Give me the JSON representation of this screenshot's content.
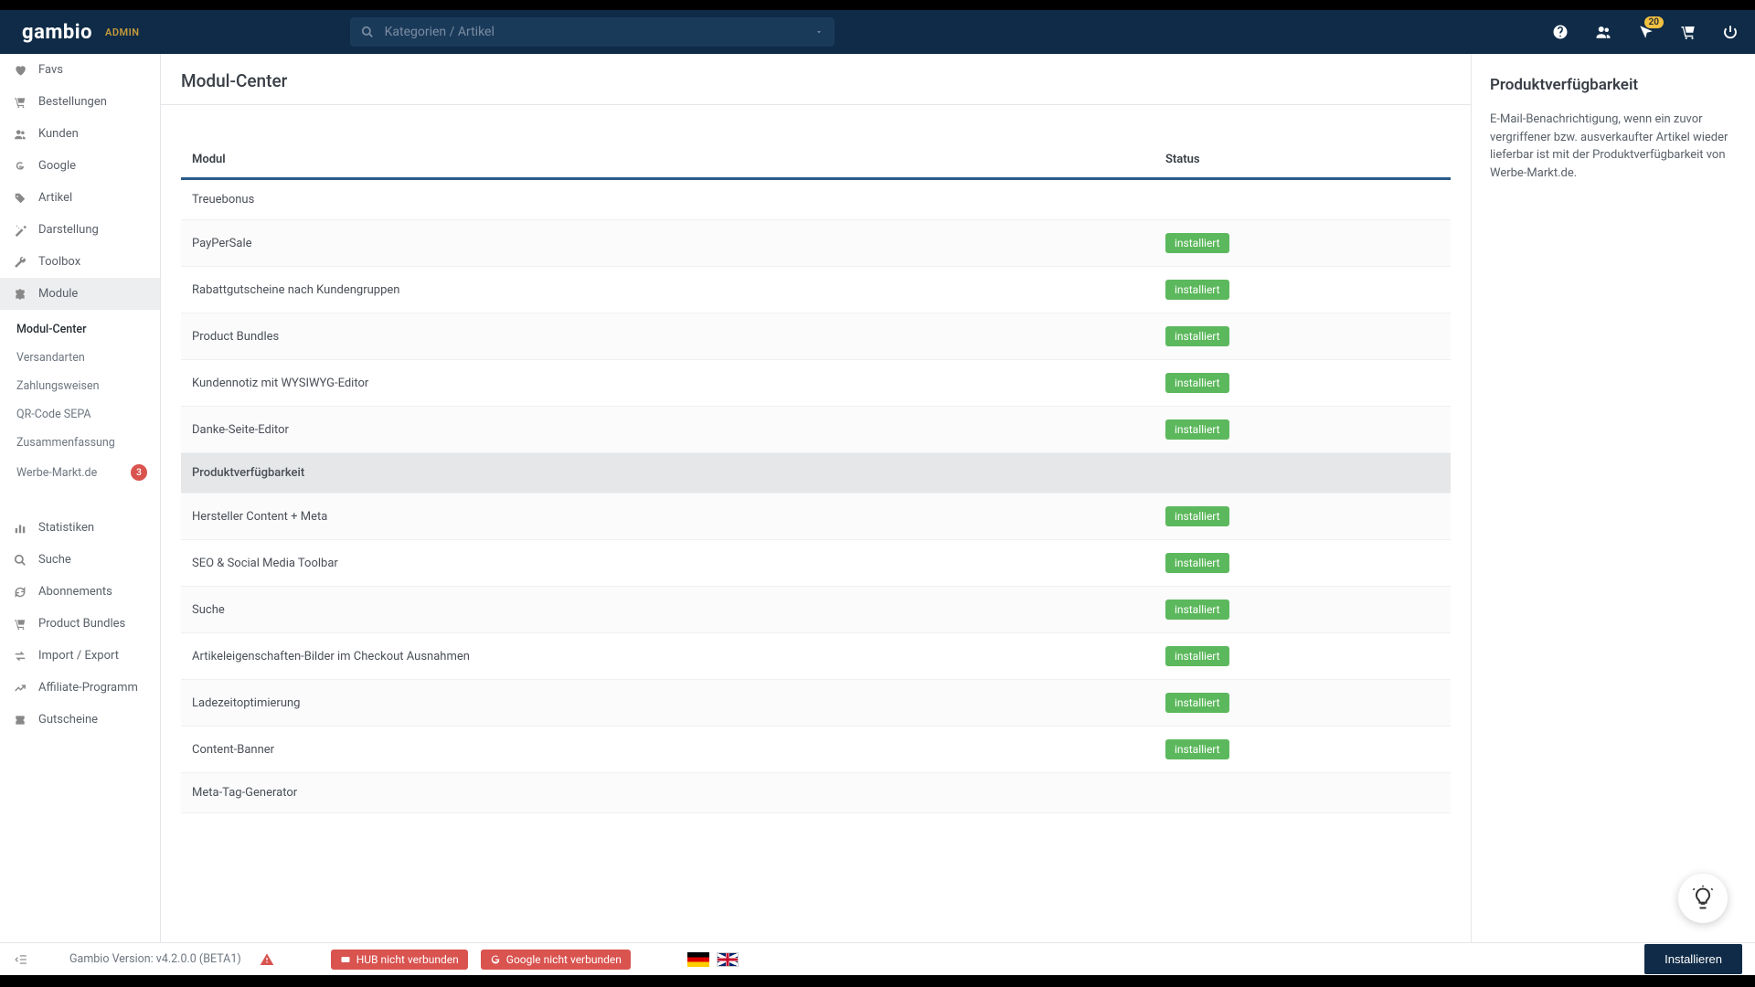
{
  "header": {
    "logo": "gambio",
    "admin_label": "ADMIN",
    "search_placeholder": "Kategorien / Artikel",
    "notification_count": "20"
  },
  "sidebar": {
    "items": [
      {
        "icon": "heart",
        "label": "Favs"
      },
      {
        "icon": "cart",
        "label": "Bestellungen"
      },
      {
        "icon": "users",
        "label": "Kunden"
      },
      {
        "icon": "google",
        "label": "Google"
      },
      {
        "icon": "tag",
        "label": "Artikel"
      },
      {
        "icon": "wand",
        "label": "Darstellung"
      },
      {
        "icon": "wrench",
        "label": "Toolbox"
      },
      {
        "icon": "puzzle",
        "label": "Module"
      }
    ],
    "subitems": [
      {
        "label": "Modul-Center",
        "active": true
      },
      {
        "label": "Versandarten"
      },
      {
        "label": "Zahlungsweisen"
      },
      {
        "label": "QR-Code SEPA"
      },
      {
        "label": "Zusammenfassung"
      },
      {
        "label": "Werbe-Markt.de",
        "badge": "3"
      }
    ],
    "items2": [
      {
        "icon": "chart",
        "label": "Statistiken"
      },
      {
        "icon": "search",
        "label": "Suche"
      },
      {
        "icon": "refresh",
        "label": "Abonnements"
      },
      {
        "icon": "cart",
        "label": "Product Bundles"
      },
      {
        "icon": "exchange",
        "label": "Import / Export"
      },
      {
        "icon": "chart-line",
        "label": "Affiliate-Programm"
      },
      {
        "icon": "ticket",
        "label": "Gutscheine"
      }
    ]
  },
  "page": {
    "title": "Modul-Center",
    "columns": {
      "modul": "Modul",
      "status": "Status"
    },
    "status_label": "installiert",
    "rows": [
      {
        "name": "Treuebonus",
        "installed": false
      },
      {
        "name": "PayPerSale",
        "installed": true
      },
      {
        "name": "Rabattgutscheine nach Kundengruppen",
        "installed": true
      },
      {
        "name": "Product Bundles",
        "installed": true
      },
      {
        "name": "Kundennotiz mit WYSIWYG-Editor",
        "installed": true
      },
      {
        "name": "Danke-Seite-Editor",
        "installed": true
      },
      {
        "name": "Produktverfügbarkeit",
        "installed": false,
        "selected": true
      },
      {
        "name": "Hersteller Content + Meta",
        "installed": true
      },
      {
        "name": "SEO & Social Media Toolbar",
        "installed": true
      },
      {
        "name": "Suche",
        "installed": true
      },
      {
        "name": "Artikeleigenschaften-Bilder im Checkout Ausnahmen",
        "installed": true
      },
      {
        "name": "Ladezeitoptimierung",
        "installed": true
      },
      {
        "name": "Content-Banner",
        "installed": true
      },
      {
        "name": "Meta-Tag-Generator",
        "installed": false
      }
    ]
  },
  "details": {
    "title": "Produktverfügbarkeit",
    "text": "E-Mail-Benachrichtigung, wenn ein zuvor vergriffener bzw. ausverkaufter Artikel wieder lieferbar ist mit der Produktverfügbarkeit von Werbe-Markt.de."
  },
  "footer": {
    "version": "Gambio Version: v4.2.0.0 (BETA1)",
    "hub_label": "HUB nicht verbunden",
    "google_label": "Google nicht verbunden",
    "install_label": "Installieren"
  }
}
